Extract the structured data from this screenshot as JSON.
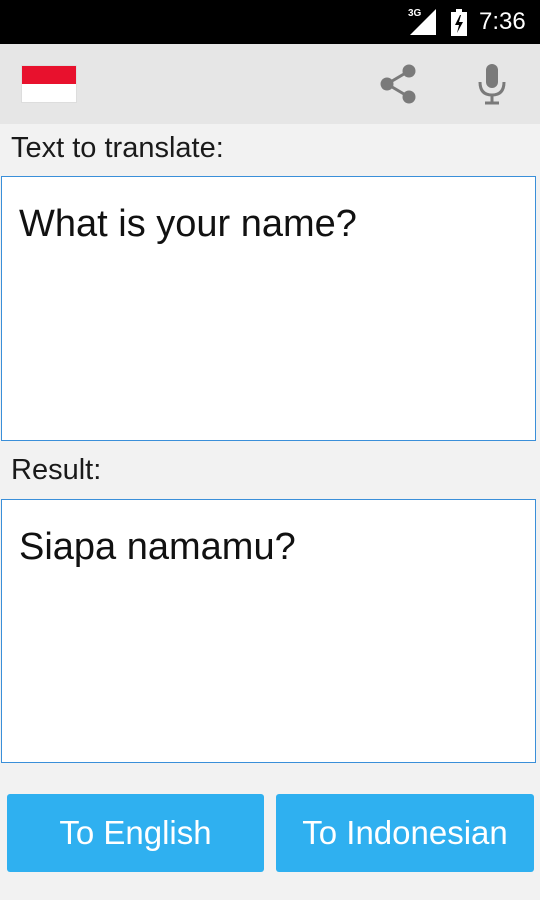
{
  "status_bar": {
    "network": "3G",
    "time": "7:36"
  },
  "toolbar": {
    "flag_icon": "indonesia-flag-icon",
    "share_icon": "share-icon",
    "mic_icon": "microphone-icon",
    "flag_colors": [
      "#e8112d",
      "#ffffff"
    ]
  },
  "input": {
    "label": "Text to translate:",
    "value": "What is your name?"
  },
  "result": {
    "label": "Result:",
    "value": "Siapa namamu?"
  },
  "buttons": {
    "to_english": "To English",
    "to_indonesian": "To Indonesian"
  },
  "colors": {
    "accent": "#2fb0f0",
    "field_border": "#3a8fd9"
  }
}
